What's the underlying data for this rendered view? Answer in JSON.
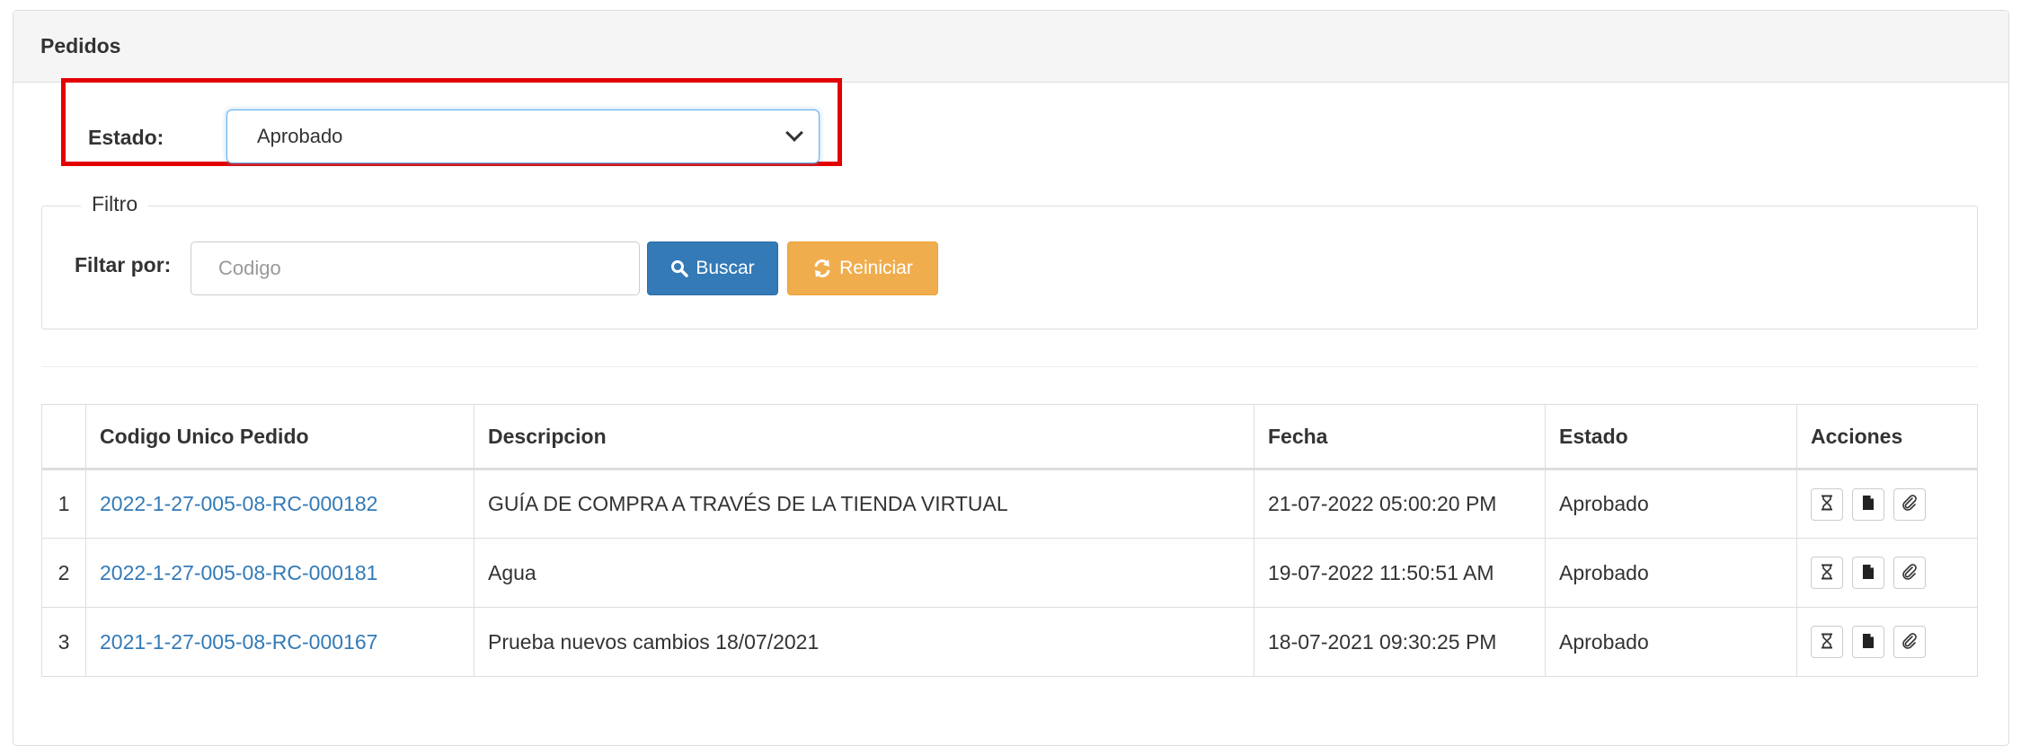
{
  "panel": {
    "title": "Pedidos"
  },
  "estado": {
    "label": "Estado:",
    "selected": "Aprobado"
  },
  "filtro": {
    "legend": "Filtro",
    "label": "Filtar por:",
    "placeholder": "Codigo",
    "buscar_label": "Buscar",
    "reiniciar_label": "Reiniciar"
  },
  "table": {
    "headers": [
      "",
      "Codigo Unico Pedido",
      "Descripcion",
      "Fecha",
      "Estado",
      "Acciones"
    ],
    "rows": [
      {
        "index": "1",
        "code": "2022-1-27-005-08-RC-000182",
        "description": "GUÍA DE COMPRA A TRAVÉS DE LA TIENDA VIRTUAL",
        "date": "21-07-2022 05:00:20 PM",
        "status": "Aprobado"
      },
      {
        "index": "2",
        "code": "2022-1-27-005-08-RC-000181",
        "description": "Agua",
        "date": "19-07-2022 11:50:51 AM",
        "status": "Aprobado"
      },
      {
        "index": "3",
        "code": "2021-1-27-005-08-RC-000167",
        "description": "Prueba nuevos cambios 18/07/2021",
        "date": "18-07-2021 09:30:25 PM",
        "status": "Aprobado"
      }
    ],
    "action_icons": [
      "hourglass-icon",
      "file-icon",
      "paperclip-icon"
    ]
  },
  "colors": {
    "highlight": "#e20000",
    "primary": "#337ab7",
    "warning": "#f0ad4e",
    "link": "#337ab7"
  }
}
